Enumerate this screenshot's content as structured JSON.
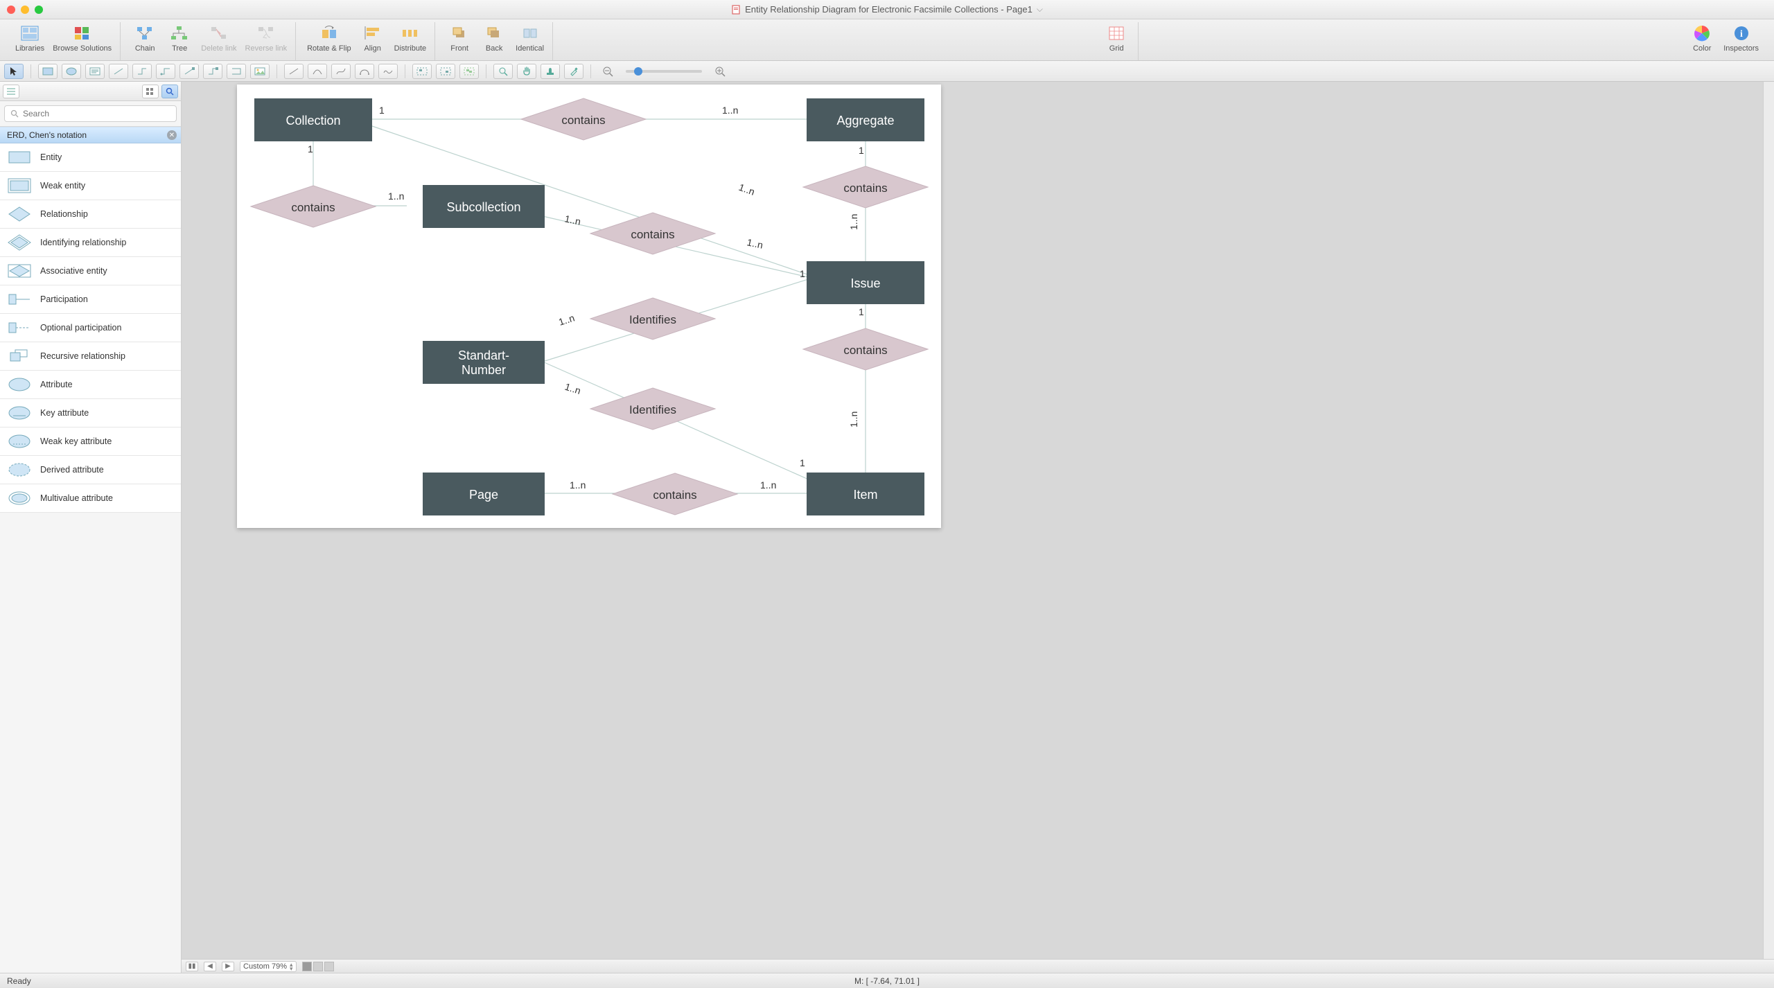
{
  "window": {
    "title": "Entity Relationship Diagram for Electronic Facsimile Collections - Page1"
  },
  "toolbar": {
    "libraries": "Libraries",
    "browse_solutions": "Browse Solutions",
    "chain": "Chain",
    "tree": "Tree",
    "delete_link": "Delete link",
    "reverse_link": "Reverse link",
    "rotate_flip": "Rotate & Flip",
    "align": "Align",
    "distribute": "Distribute",
    "front": "Front",
    "back": "Back",
    "identical": "Identical",
    "grid": "Grid",
    "color": "Color",
    "inspectors": "Inspectors"
  },
  "sidebar": {
    "search_placeholder": "Search",
    "category": "ERD, Chen's notation",
    "items": [
      {
        "label": "Entity"
      },
      {
        "label": "Weak entity"
      },
      {
        "label": "Relationship"
      },
      {
        "label": "Identifying relationship"
      },
      {
        "label": "Associative entity"
      },
      {
        "label": "Participation"
      },
      {
        "label": "Optional participation"
      },
      {
        "label": "Recursive relationship"
      },
      {
        "label": "Attribute"
      },
      {
        "label": "Key attribute"
      },
      {
        "label": "Weak key attribute"
      },
      {
        "label": "Derived attribute"
      },
      {
        "label": "Multivalue attribute"
      }
    ]
  },
  "diagram": {
    "entities": {
      "collection": "Collection",
      "aggregate": "Aggregate",
      "subcollection": "Subcollection",
      "issue": "Issue",
      "standart_number_l1": "Standart-",
      "standart_number_l2": "Number",
      "page": "Page",
      "item": "Item"
    },
    "relationships": {
      "contains": "contains",
      "identifies": "Identifies"
    },
    "cardinality": {
      "one": "1",
      "one_n": "1..n"
    }
  },
  "canvas_bottom": {
    "zoom_label": "Custom 79%"
  },
  "statusbar": {
    "ready": "Ready",
    "mouse": "M: [ -7.64, 71.01 ]"
  }
}
